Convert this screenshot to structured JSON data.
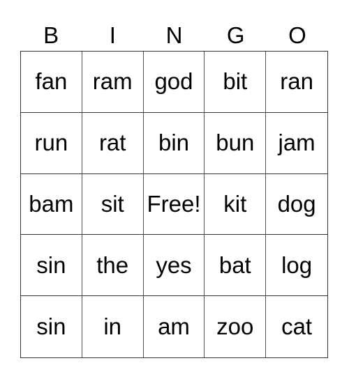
{
  "header": [
    "B",
    "I",
    "N",
    "G",
    "O"
  ],
  "cells": [
    [
      "fan",
      "ram",
      "god",
      "bit",
      "ran"
    ],
    [
      "run",
      "rat",
      "bin",
      "bun",
      "jam"
    ],
    [
      "bam",
      "sit",
      "Free!",
      "kit",
      "dog"
    ],
    [
      "sin",
      "the",
      "yes",
      "bat",
      "log"
    ],
    [
      "sin",
      "in",
      "am",
      "zoo",
      "cat"
    ]
  ]
}
